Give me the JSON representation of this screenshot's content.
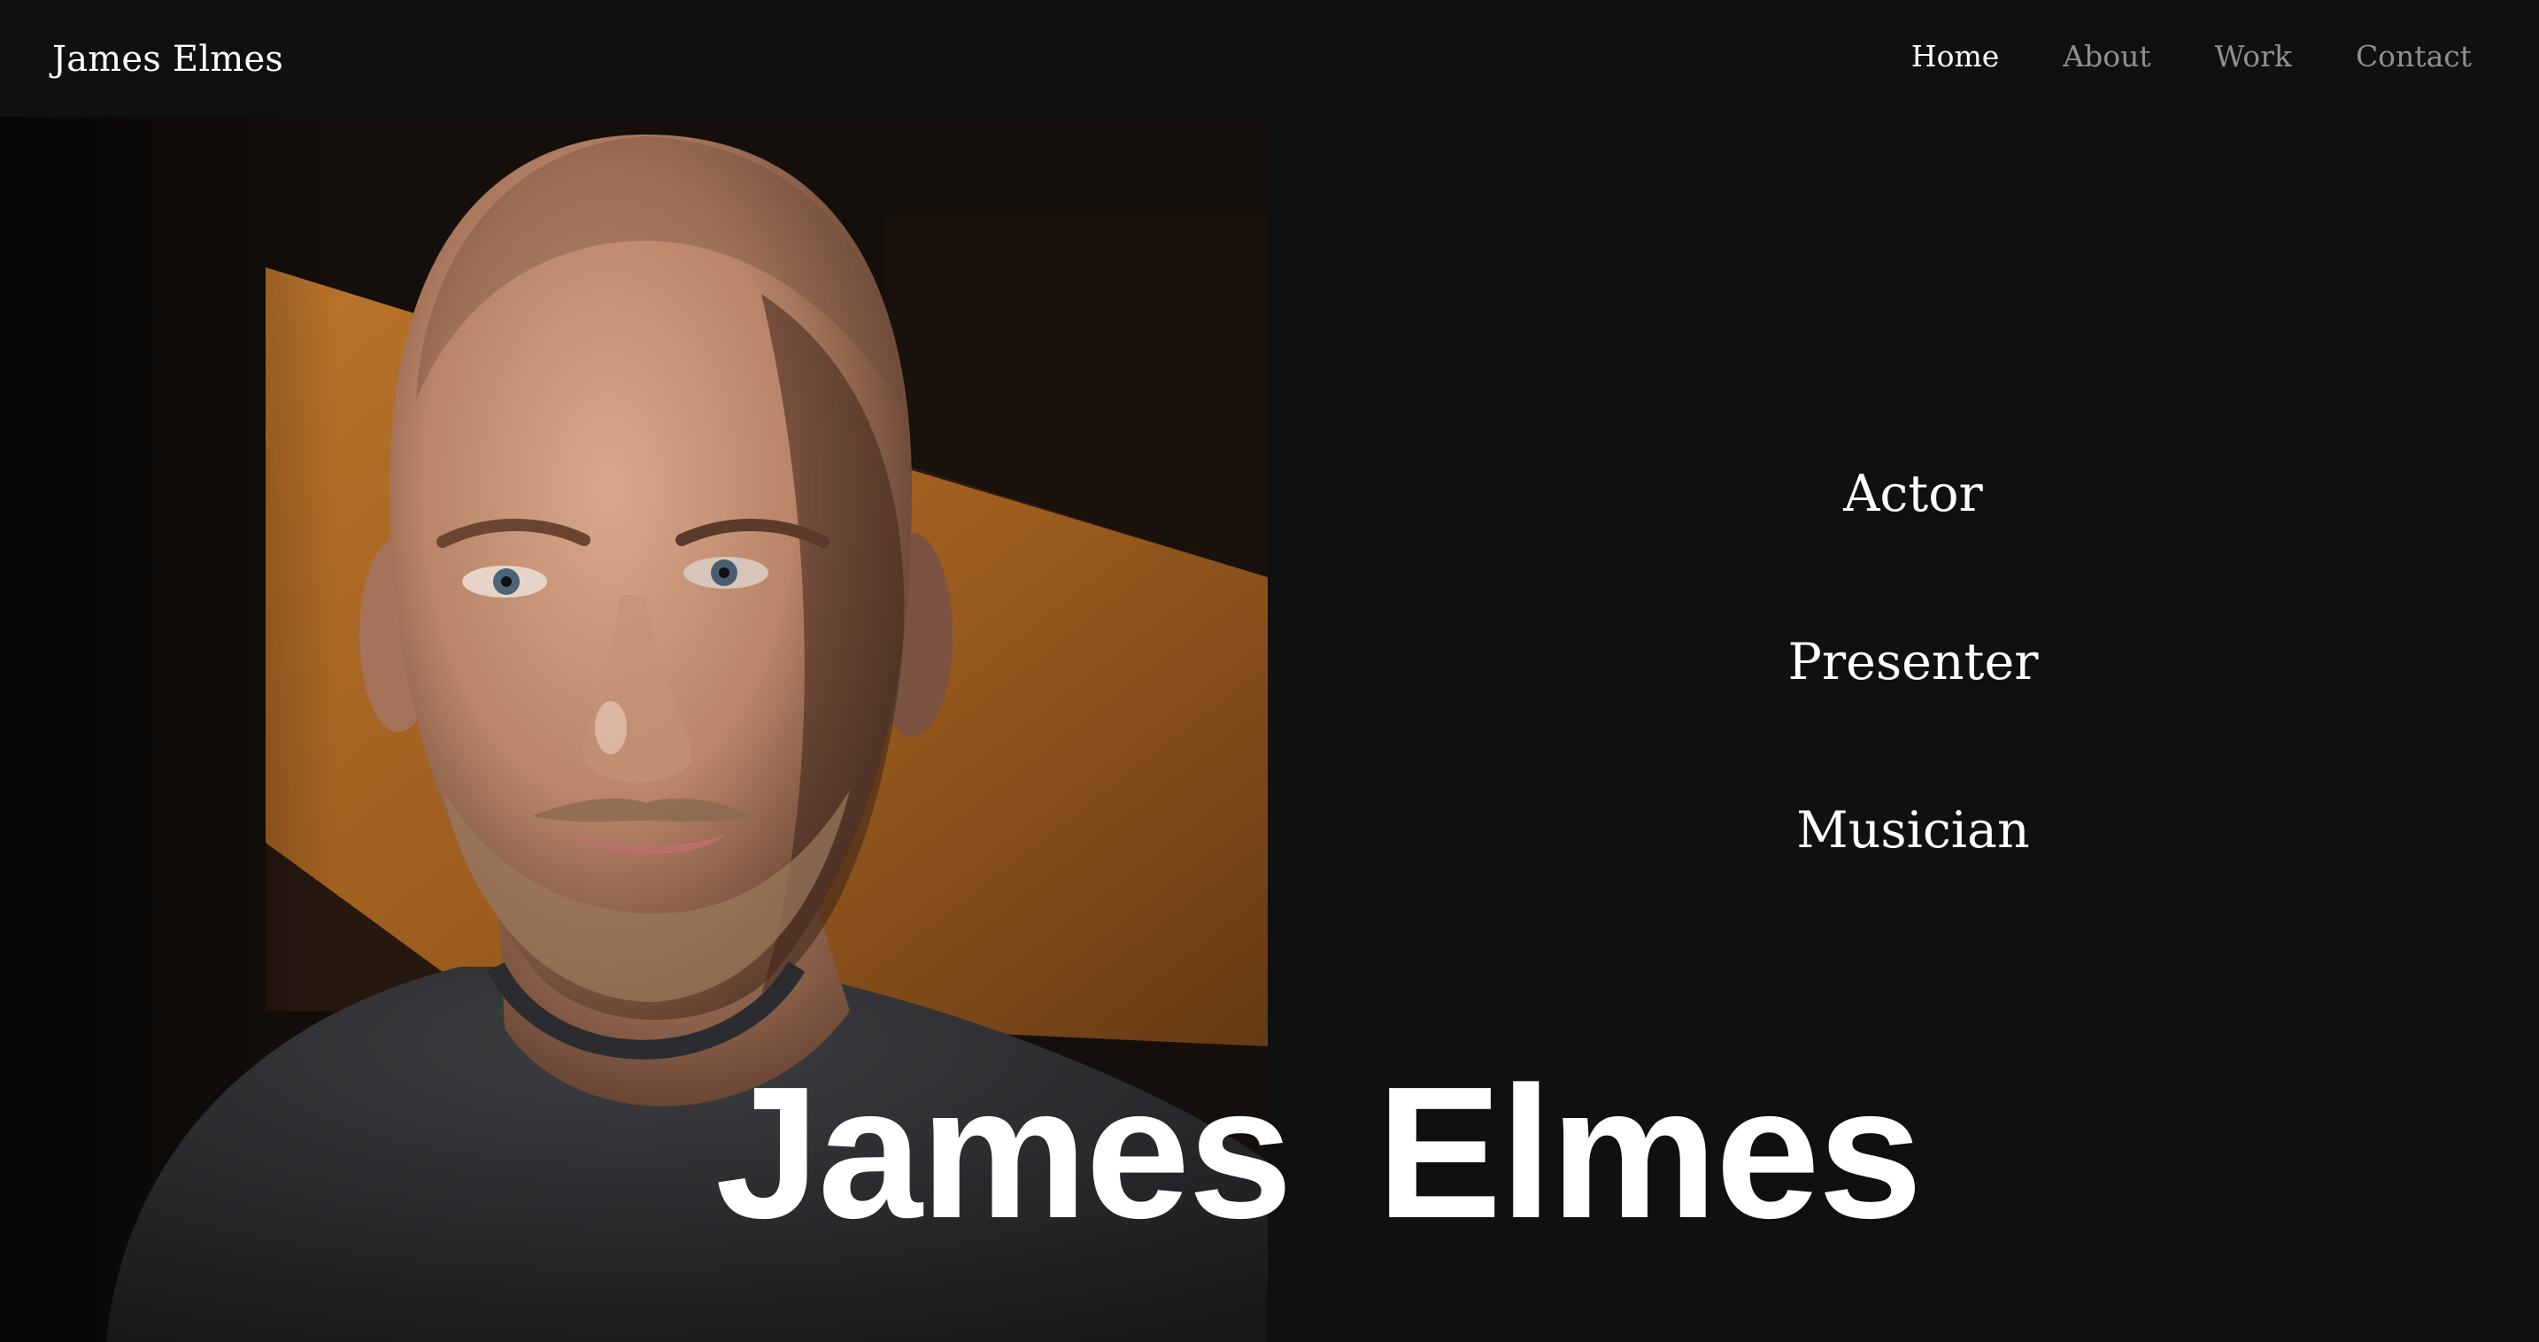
{
  "header": {
    "site_title": "James Elmes",
    "nav": [
      {
        "label": "Home",
        "active": true
      },
      {
        "label": "About",
        "active": false
      },
      {
        "label": "Work",
        "active": false
      },
      {
        "label": "Contact",
        "active": false
      }
    ]
  },
  "hero": {
    "roles": [
      "Actor",
      "Presenter",
      "Musician"
    ],
    "name": "James Elmes"
  },
  "colors": {
    "background": "#0f1110",
    "text": "#ffffff",
    "nav_inactive": "#8f8f8f",
    "wall_light": "#b06a24"
  }
}
